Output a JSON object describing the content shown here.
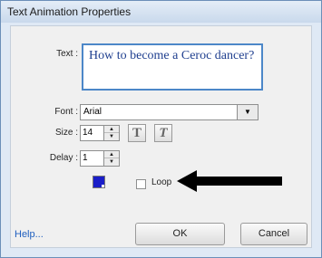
{
  "window": {
    "title": "Text Animation Properties"
  },
  "fields": {
    "text_label": "Text :",
    "text_value": "How to become a Ceroc dancer?",
    "font_label": "Font :",
    "font_value": "Arial",
    "size_label": "Size :",
    "size_value": "14",
    "delay_label": "Delay :",
    "delay_value": "1"
  },
  "format": {
    "bold_glyph": "T",
    "italic_glyph": "T"
  },
  "color": {
    "text_color": "#1a1ec8"
  },
  "loop": {
    "label": "Loop",
    "checked": false
  },
  "buttons": {
    "help": "Help...",
    "ok": "OK",
    "cancel": "Cancel"
  },
  "icons": {
    "dropdown": "chevron-down-icon",
    "spin_up": "spin-up-icon",
    "spin_down": "spin-down-icon",
    "annotation": "arrow-left-icon"
  }
}
